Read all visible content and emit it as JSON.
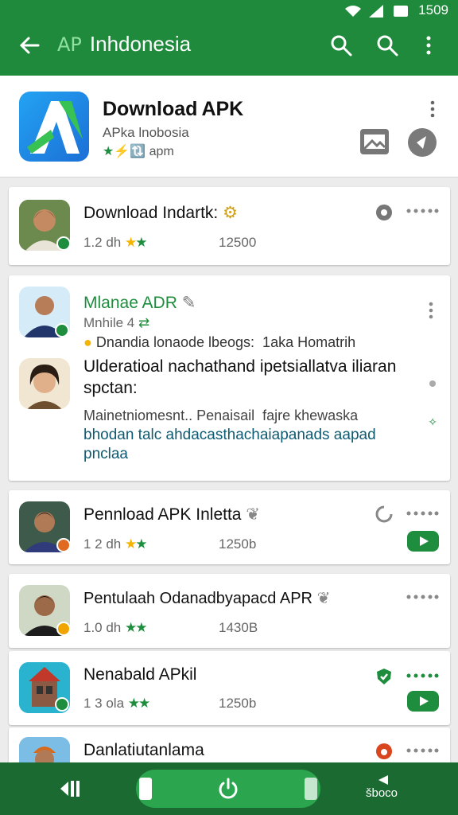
{
  "status": {
    "time": "1509"
  },
  "appbar": {
    "abbr": "AP",
    "title": "Inhdonesia"
  },
  "header": {
    "title": "Download APK",
    "subtitle": "APka lnobosia",
    "meta_green": "★⚡🔃",
    "meta": "apm"
  },
  "items": [
    {
      "title": "Download Indartk:",
      "rating": "1.2 dh",
      "size": "12500"
    },
    {
      "title": "Mlanae ADR",
      "subtitle": "Mnhile 4",
      "line1": "Dnandia lonaode lbeogs:  1aka Homatrih",
      "line2": "Ulderatioal nachathand ipetsiallatva iliaran",
      "line3": "spctan:",
      "line4": "Mainetniomesnt.. Penaisail  fajre khewaska",
      "line5": "bhodan talc ahdacasthachaiapanads aapad",
      "line6": "pnclaa"
    },
    {
      "title": "Pennload APK Inletta",
      "rating": "1 2 dh",
      "size": "1250b"
    },
    {
      "title": "Pentulaah Odanadbyapacd APR",
      "rating": "1.0 dh",
      "size": "1430B"
    },
    {
      "title": "Nenabald APkil",
      "rating": "1 3 ola",
      "size": "1250b"
    },
    {
      "title": "Danlatiutanlama"
    }
  ],
  "navbar": {
    "label": "šboco"
  },
  "colors": {
    "primary": "#1f8a3c",
    "accent_green": "#1e8e3e",
    "star": "#f4b400"
  }
}
